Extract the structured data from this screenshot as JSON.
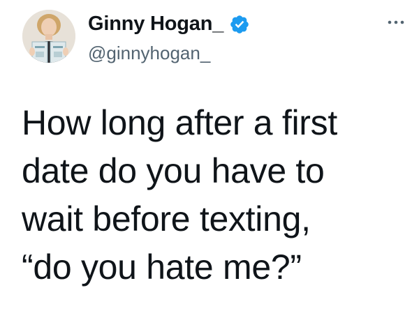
{
  "tweet": {
    "display_name": "Ginny Hogan_",
    "handle": "@ginnyhogan_",
    "text": "How long after a first\ndate do you have to\nwait before texting,\n“do you hate me?”"
  },
  "icons": {
    "verified": "verified-badge-icon",
    "more": "more-options-icon"
  },
  "colors": {
    "verified_blue": "#1d9bf0",
    "text": "#0f1419",
    "secondary_text": "#536471"
  }
}
